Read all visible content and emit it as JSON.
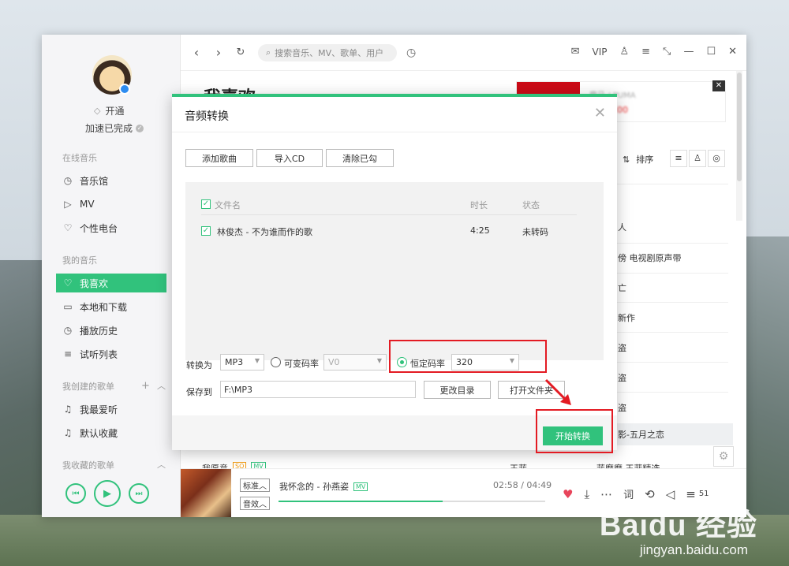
{
  "sidebar": {
    "vip_label": "开通",
    "speed_label": "加速已完成",
    "online_section": "在线音乐",
    "online_items": [
      {
        "label": "音乐馆",
        "icon": "music-hall-icon"
      },
      {
        "label": "MV",
        "icon": "mv-icon"
      },
      {
        "label": "个性电台",
        "icon": "radio-icon"
      }
    ],
    "my_section": "我的音乐",
    "my_items": [
      {
        "label": "我喜欢",
        "icon": "heart-icon"
      },
      {
        "label": "本地和下载",
        "icon": "monitor-icon"
      },
      {
        "label": "播放历史",
        "icon": "clock-icon"
      },
      {
        "label": "试听列表",
        "icon": "list-icon"
      }
    ],
    "created_section": "我创建的歌单",
    "created_items": [
      {
        "label": "我最爱听",
        "icon": "note-icon"
      },
      {
        "label": "默认收藏",
        "icon": "note-icon"
      }
    ],
    "collected_section": "我收藏的歌单"
  },
  "topbar": {
    "search_placeholder": "搜索音乐、MV、歌单、用户",
    "vip": "VIP"
  },
  "background": {
    "page_title": "我喜欢",
    "sort_label": "排序",
    "rows": [
      "人",
      "傍 电视剧原声带",
      "亡",
      "新作",
      "盗",
      "盗",
      "盗"
    ],
    "highlight_row": "影-五月之恋",
    "bottom_song": "我愿意",
    "bottom_song_tag1": "SQ",
    "bottom_song_tag2": "MV",
    "bottom_artist": "王菲",
    "bottom_album": "菲靡靡 王菲精选"
  },
  "player": {
    "quality": "标准",
    "effect": "音效",
    "song": "我怀念的 - 孙燕姿",
    "mv_tag": "MV",
    "time": "02:58 / 04:49",
    "progress": 0.616,
    "lyric_icon": "词",
    "count": "51"
  },
  "dialog": {
    "title": "音频转换",
    "buttons": [
      "添加歌曲",
      "导入CD",
      "清除已勾"
    ],
    "col_name": "文件名",
    "col_duration": "时长",
    "col_status": "状态",
    "rows": [
      {
        "name": "林俊杰 - 不为谁而作的歌",
        "duration": "4:25",
        "status": "未转码",
        "checked": true
      }
    ],
    "convert_label": "转换为",
    "format": "MP3",
    "vbr_label": "可变码率",
    "vbr_value": "V0",
    "cbr_label": "恒定码率",
    "cbr_value": "320",
    "save_label": "保存到",
    "save_path": "F:\\MP3",
    "change_dir": "更改目录",
    "open_folder": "打开文件夹",
    "start": "开始转换"
  },
  "watermark": {
    "brand": "Baidu 经验",
    "url": "jingyan.baidu.com"
  },
  "colors": {
    "accent": "#31c27c",
    "annotation": "#e31b23"
  }
}
